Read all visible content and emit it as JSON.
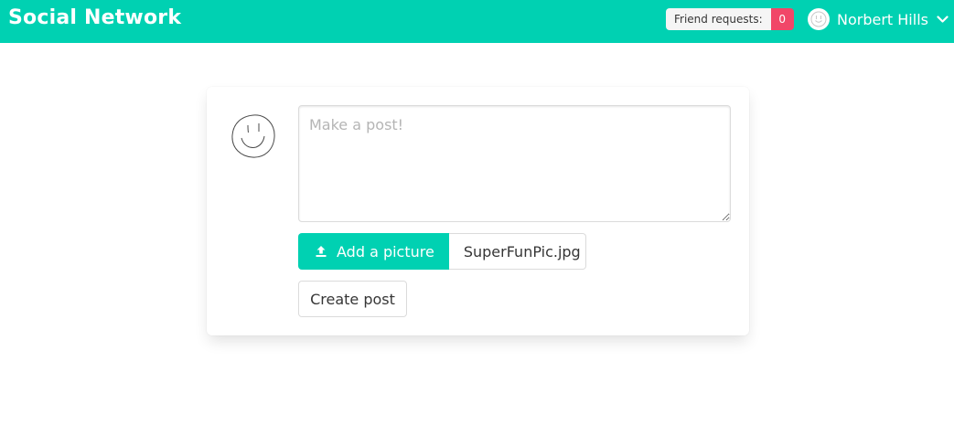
{
  "navbar": {
    "brand": "Social Network",
    "friend_requests_label": "Friend requests:",
    "friend_requests_count": "0",
    "user_name": "Norbert Hills",
    "user_icon": "smiley-avatar-icon",
    "menu_icon": "chevron-down-icon"
  },
  "post_form": {
    "avatar_icon": "smiley-face-icon",
    "textarea_placeholder": "Make a post!",
    "textarea_value": "",
    "upload_icon": "upload-icon",
    "add_picture_label": "Add a picture",
    "selected_file": "SuperFunPic.jpg",
    "create_post_label": "Create post"
  },
  "colors": {
    "primary": "#00d1b2",
    "danger": "#f14668",
    "background": "#ffffff",
    "text": "#363636"
  }
}
